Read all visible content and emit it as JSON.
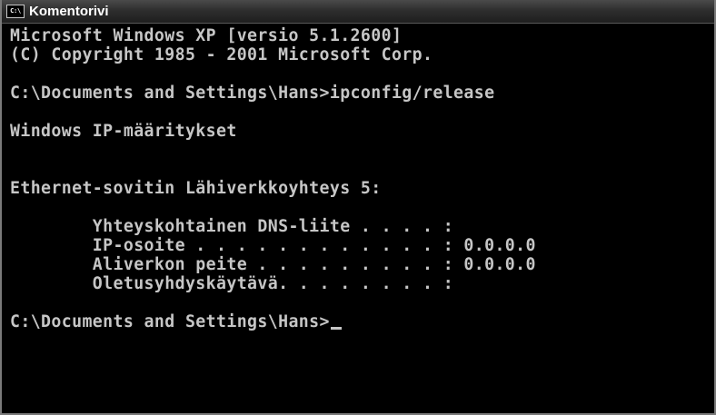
{
  "window": {
    "title": "Komentorivi",
    "icon_name": "console-app-icon",
    "icon_glyph": "C:\\"
  },
  "console": {
    "lines": [
      "Microsoft Windows XP [versio 5.1.2600]",
      "(C) Copyright 1985 - 2001 Microsoft Corp.",
      "",
      "C:\\Documents and Settings\\Hans>ipconfig/release",
      "",
      "Windows IP-määritykset",
      "",
      "",
      "Ethernet-sovitin Lähiverkkoyhteys 5:",
      "",
      "        Yhteyskohtainen DNS-liite . . . . :",
      "        IP-osoite . . . . . . . . . . . . : 0.0.0.0",
      "        Aliverkon peite . . . . . . . . . : 0.0.0.0",
      "        Oletusyhdyskäytävä. . . . . . . . :",
      ""
    ],
    "prompt": "C:\\Documents and Settings\\Hans>"
  },
  "colors": {
    "background": "#000000",
    "text": "#c6c6c6",
    "titlebar": "#2e2e2e"
  }
}
